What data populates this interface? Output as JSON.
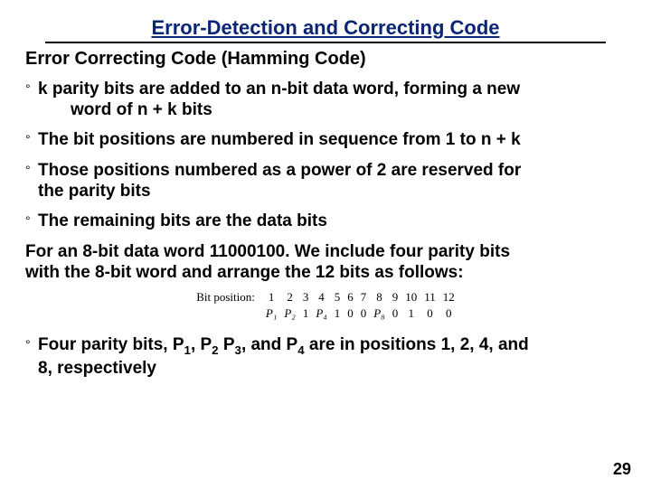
{
  "title": "Error-Detection and Correcting Code",
  "subtitle": "Error Correcting Code (Hamming Code)",
  "bullets": {
    "b1a": " k parity bits are added to an  n-bit data word, forming a new",
    "b1b": "word of n + k bits",
    "b2": "The bit positions are numbered in sequence from 1 to n + k",
    "b3a": "Those positions numbered as a power of 2 are reserved for",
    "b3b": "the parity bits",
    "b4": "The remaining bits are the data bits",
    "b5a": "Four parity bits, P",
    "b5b": ", P",
    "b5c": " P",
    "b5d": ", and P",
    "b5e": " are in positions 1, 2, 4, and",
    "b5f": "8, respectively"
  },
  "example": {
    "l1": "For an 8-bit data word 11000100. We include four parity bits",
    "l2": "with the 8-bit word and arrange the 12 bits as follows:"
  },
  "table": {
    "label": "Bit position:",
    "positions": [
      "1",
      "2",
      "3",
      "4",
      "5",
      "6",
      "7",
      "8",
      "9",
      "10",
      "11",
      "12"
    ],
    "cells": [
      "P₁",
      "P₂",
      "1",
      "P₄",
      "1",
      "0",
      "0",
      "P₈",
      "0",
      "1",
      "0",
      "0"
    ]
  },
  "subs": {
    "s1": "1",
    "s2": "2",
    "s3": "3",
    "s4": "4"
  },
  "pagenum": "29"
}
